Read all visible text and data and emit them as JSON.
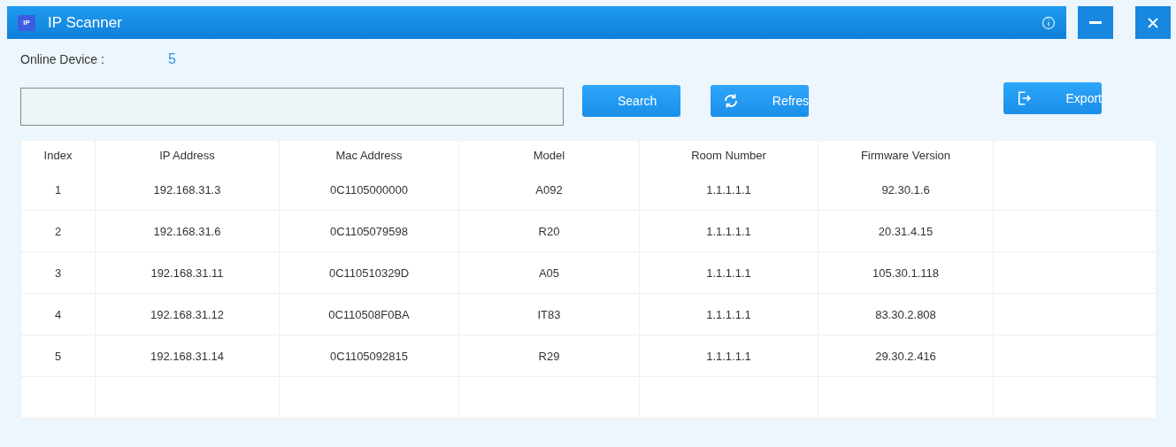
{
  "window": {
    "logo": "IP",
    "title": "IP Scanner"
  },
  "online_device": {
    "label": "Online Device :",
    "count": "5"
  },
  "buttons": [
    {
      "kind": "search",
      "label": "Search"
    },
    {
      "kind": "refresh",
      "label": "Refres"
    },
    {
      "kind": "export",
      "label": "Export"
    }
  ],
  "table": {
    "columns": [
      "Index",
      "IP Address",
      "Mac Address",
      "Model",
      "Room Number",
      "Firmware Version"
    ],
    "rows": [
      [
        "1",
        "192.168.31.3",
        "0C1105000000",
        "A092",
        "1.1.1.1.1",
        "92.30.1.6"
      ],
      [
        "2",
        "192.168.31.6",
        "0C1105079598",
        "R20",
        "1.1.1.1.1",
        "20.31.4.15"
      ],
      [
        "3",
        "192.168.31.11",
        "0C110510329D",
        "A05",
        "1.1.1.1.1",
        "105.30.1.118"
      ],
      [
        "4",
        "192.168.31.12",
        "0C110508F0BA",
        "IT83",
        "1.1.1.1.1",
        "83.30.2.808"
      ],
      [
        "5",
        "192.168.31.14",
        "0C1105092815",
        "R29",
        "1.1.1.1.1",
        "29.30.2.416"
      ]
    ]
  }
}
